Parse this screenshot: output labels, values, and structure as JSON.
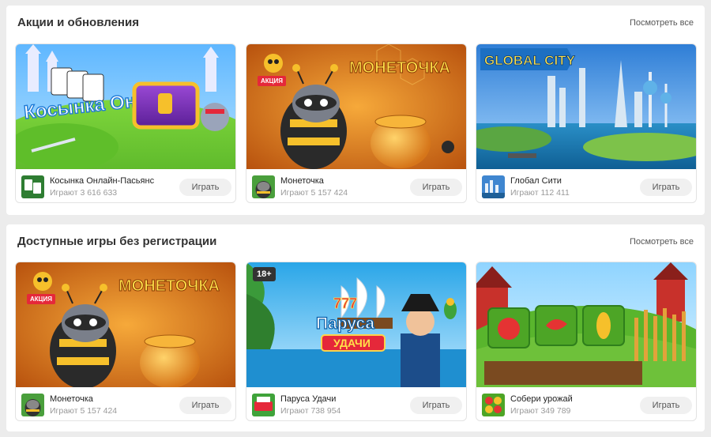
{
  "sections": [
    {
      "title": "Акции и обновления",
      "see_all": "Посмотреть все",
      "cards": [
        {
          "name": "Косынка Онлайн-Пасьянс",
          "players_label": "Играют",
          "players": "3 616 633",
          "play": "Играть",
          "banner_text": "Косынка Онлайн!"
        },
        {
          "name": "Монеточка",
          "players_label": "Играют",
          "players": "5 157 424",
          "play": "Играть",
          "banner_text": "МОНЕТОЧКА",
          "badge": "АКЦИЯ"
        },
        {
          "name": "Глобал Сити",
          "players_label": "Играют",
          "players": "112 411",
          "play": "Играть",
          "banner_text": "GLOBAL CITY"
        }
      ]
    },
    {
      "title": "Доступные игры без регистрации",
      "see_all": "Посмотреть все",
      "cards": [
        {
          "name": "Монеточка",
          "players_label": "Играют",
          "players": "5 157 424",
          "play": "Играть",
          "banner_text": "МОНЕТОЧКА",
          "badge": "АКЦИЯ"
        },
        {
          "name": "Паруса Удачи",
          "players_label": "Играют",
          "players": "738 954",
          "play": "Играть",
          "banner_text": "Паруса",
          "banner_text2": "УДАЧИ",
          "banner_num": "777",
          "age": "18+"
        },
        {
          "name": "Собери урожай",
          "players_label": "Играют",
          "players": "349 789",
          "play": "Играть"
        }
      ]
    }
  ],
  "colors": {
    "accent": "#e5283a",
    "button_bg": "#f0f0f0",
    "page_bg": "#ececec"
  }
}
